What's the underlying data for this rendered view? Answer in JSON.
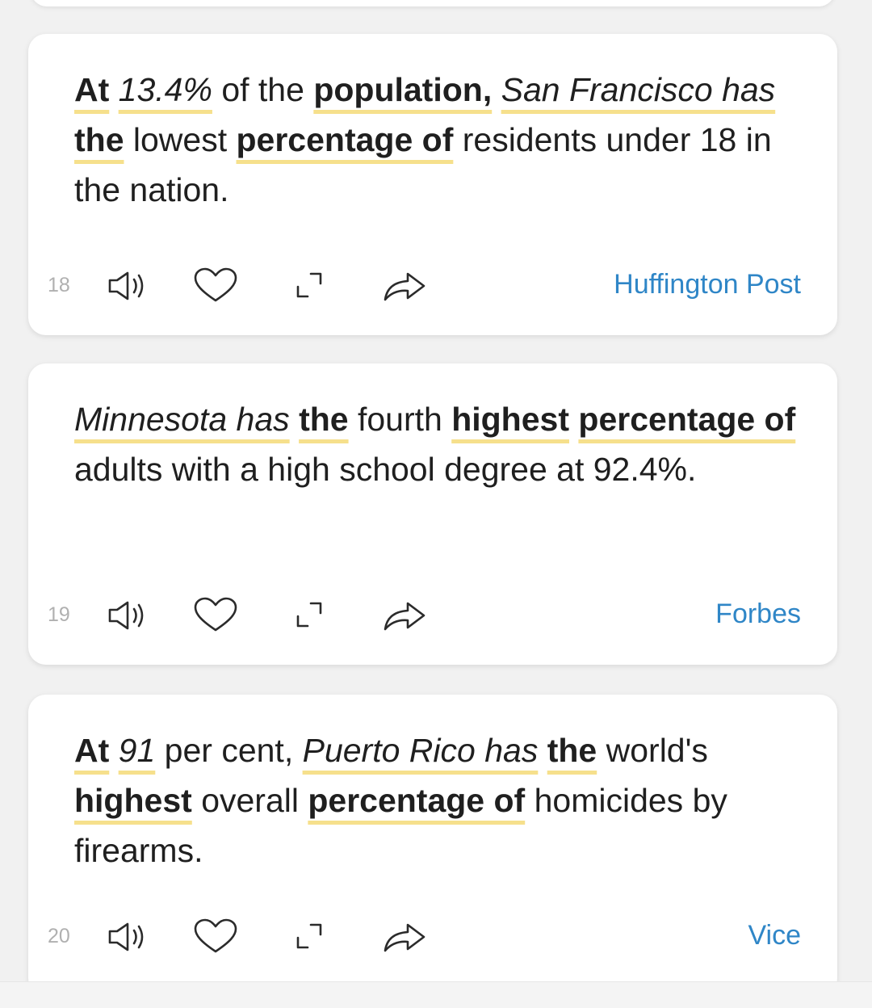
{
  "cards": [
    {
      "number": "18",
      "source": "Huffington Post",
      "segments": [
        {
          "text": "At",
          "bold": true,
          "italic": false,
          "hl": true
        },
        {
          "text": " ",
          "bold": false,
          "italic": false,
          "hl": false
        },
        {
          "text": "13.4%",
          "bold": false,
          "italic": true,
          "hl": true
        },
        {
          "text": " of the ",
          "bold": false,
          "italic": false,
          "hl": false
        },
        {
          "text": "population,",
          "bold": true,
          "italic": false,
          "hl": true
        },
        {
          "text": " ",
          "bold": false,
          "italic": false,
          "hl": false
        },
        {
          "text": "San Francisco has",
          "bold": false,
          "italic": true,
          "hl": true
        },
        {
          "text": " ",
          "bold": false,
          "italic": false,
          "hl": false
        },
        {
          "text": "the",
          "bold": true,
          "italic": false,
          "hl": true
        },
        {
          "text": " lowest ",
          "bold": false,
          "italic": false,
          "hl": false
        },
        {
          "text": "percentage of",
          "bold": true,
          "italic": false,
          "hl": true
        },
        {
          "text": " residents under 18 in the nation.",
          "bold": false,
          "italic": false,
          "hl": false
        }
      ]
    },
    {
      "number": "19",
      "source": "Forbes",
      "segments": [
        {
          "text": "Minnesota has",
          "bold": false,
          "italic": true,
          "hl": true
        },
        {
          "text": " ",
          "bold": false,
          "italic": false,
          "hl": false
        },
        {
          "text": "the",
          "bold": true,
          "italic": false,
          "hl": true
        },
        {
          "text": " fourth ",
          "bold": false,
          "italic": false,
          "hl": false
        },
        {
          "text": "highest",
          "bold": true,
          "italic": false,
          "hl": true
        },
        {
          "text": " ",
          "bold": false,
          "italic": false,
          "hl": false
        },
        {
          "text": "percentage of",
          "bold": true,
          "italic": false,
          "hl": true
        },
        {
          "text": " adults with a high school degree at 92.4%.",
          "bold": false,
          "italic": false,
          "hl": false
        }
      ]
    },
    {
      "number": "20",
      "source": "Vice",
      "segments": [
        {
          "text": "At",
          "bold": true,
          "italic": false,
          "hl": true
        },
        {
          "text": " ",
          "bold": false,
          "italic": false,
          "hl": false
        },
        {
          "text": "91",
          "bold": false,
          "italic": true,
          "hl": true
        },
        {
          "text": " per cent, ",
          "bold": false,
          "italic": false,
          "hl": false
        },
        {
          "text": "Puerto Rico has",
          "bold": false,
          "italic": true,
          "hl": true
        },
        {
          "text": " ",
          "bold": false,
          "italic": false,
          "hl": false
        },
        {
          "text": "the",
          "bold": true,
          "italic": false,
          "hl": true
        },
        {
          "text": " world's ",
          "bold": false,
          "italic": false,
          "hl": false
        },
        {
          "text": "highest",
          "bold": true,
          "italic": false,
          "hl": true
        },
        {
          "text": " overall ",
          "bold": false,
          "italic": false,
          "hl": false
        },
        {
          "text": "percentage of",
          "bold": true,
          "italic": false,
          "hl": true
        },
        {
          "text": " homicides by firearms.",
          "bold": false,
          "italic": false,
          "hl": false
        }
      ]
    }
  ],
  "icons": {
    "listen": "speaker-icon",
    "like": "heart-icon",
    "expand": "expand-icon",
    "share": "share-icon"
  },
  "colors": {
    "highlight": "#f6e08c",
    "source_link": "#2f86c7",
    "number": "#b0b0b0",
    "icon_stroke": "#2b2b2b"
  }
}
